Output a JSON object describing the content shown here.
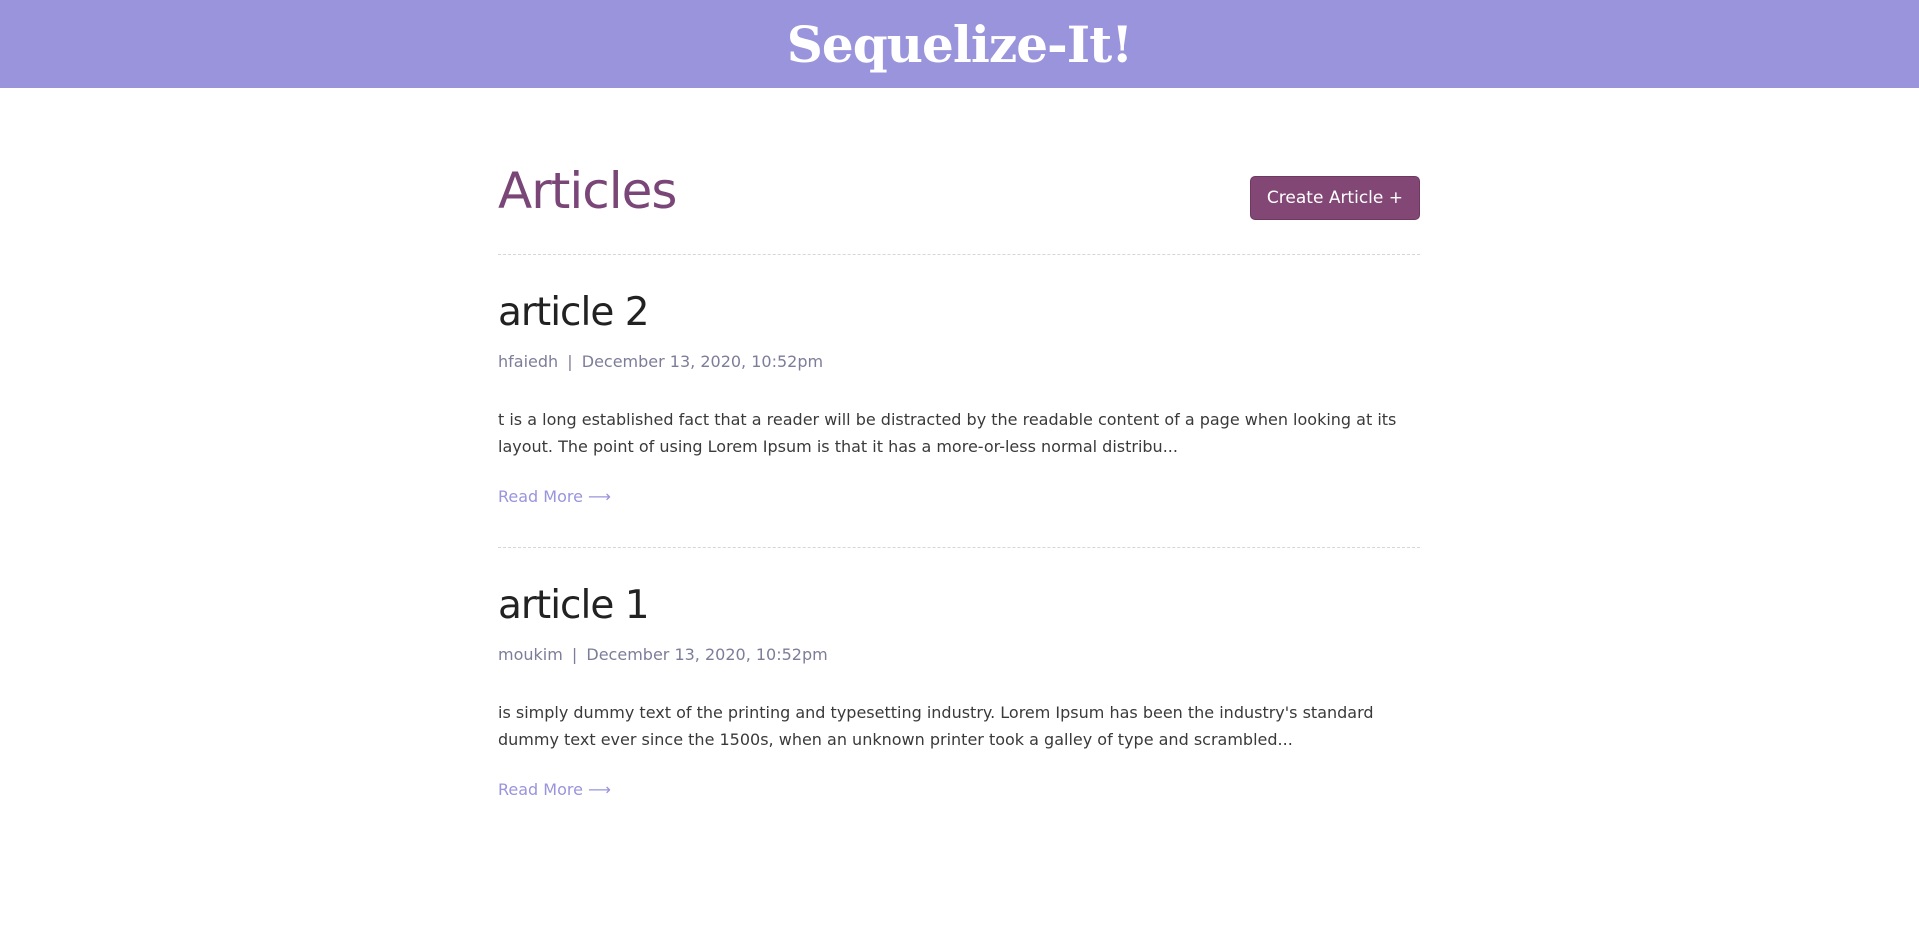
{
  "header": {
    "brand": "Sequelize-It!",
    "background": "#9994dc"
  },
  "page": {
    "title": "Articles",
    "create_button": "Create Article +"
  },
  "articles": [
    {
      "title": "article 2",
      "author": "hfaiedh",
      "separator": "|",
      "date": "December 13, 2020, 10:52pm",
      "excerpt": "t is a long established fact that a reader will be distracted by the readable content of a page when looking at its layout. The point of using Lorem Ipsum is that it has a more-or-less normal distribu...",
      "read_more": "Read More ⟶"
    },
    {
      "title": "article 1",
      "author": "moukim",
      "separator": "|",
      "date": "December 13, 2020, 10:52pm",
      "excerpt": "is simply dummy text of the printing and typesetting industry. Lorem Ipsum has been the industry's standard dummy text ever since the 1500s, when an unknown printer took a galley of type and scrambled...",
      "read_more": "Read More ⟶"
    }
  ],
  "colors": {
    "accent": "#7a4677",
    "button": "#834775",
    "link": "#9994dc"
  }
}
